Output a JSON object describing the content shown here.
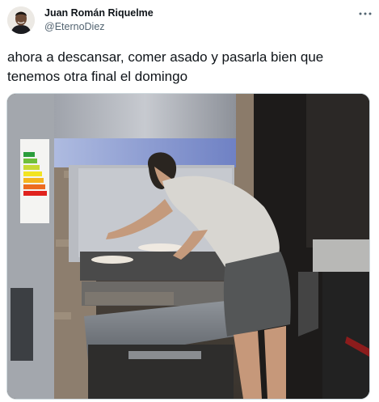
{
  "tweet": {
    "author_name": "Juan Román Riquelme",
    "author_handle": "@EternoDiez",
    "text": "ahora a descansar, comer asado y pasarla bien que tenemos otra final el domingo",
    "more_icon": "more-horizontal-icon"
  },
  "media": {
    "description_icon": "photo",
    "has_verified_badge": false
  },
  "colors": {
    "text": "#0f1419",
    "secondary": "#536471",
    "border": "#cfd9de"
  }
}
